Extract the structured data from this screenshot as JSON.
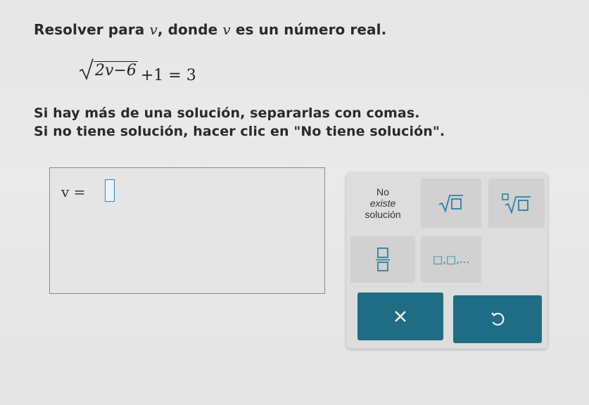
{
  "problem": {
    "prompt_before": "Resolver para ",
    "prompt_var": "v",
    "prompt_mid": ", donde ",
    "prompt_var2": "v",
    "prompt_after": " es un número real.",
    "radicand": "2v−6",
    "equation_rest": "+1 = 3",
    "instruction_1": "Si hay más de una solución, separarlas con comas.",
    "instruction_2": "Si no tiene solución, hacer clic en \"No tiene solución\"."
  },
  "answer": {
    "label": "v =",
    "value": ""
  },
  "keypad": {
    "no_solution_line1": "No",
    "no_solution_line2": "existe",
    "no_solution_line3": "solución",
    "list_label": "□,□,...",
    "clear_icon": "x-icon",
    "undo_icon": "undo-icon"
  },
  "colors": {
    "accent": "#2f7fa6",
    "button": "#1f6d84"
  }
}
